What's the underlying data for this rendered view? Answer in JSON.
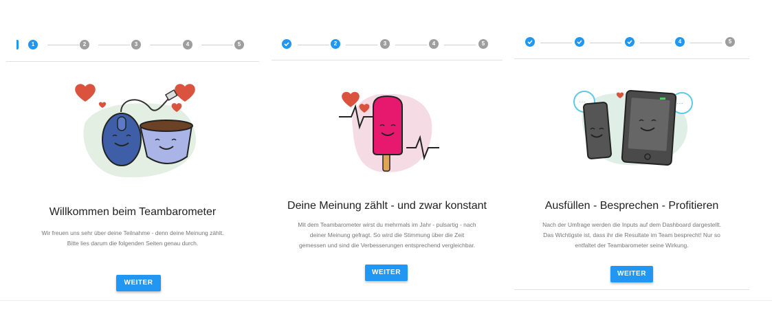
{
  "colors": {
    "accent": "#2196f3",
    "inactive_step": "#9e9e9e",
    "heart": "#d9533f"
  },
  "panels": [
    {
      "steps": [
        "1",
        "2",
        "3",
        "4",
        "5"
      ],
      "active_step": 1,
      "title": "Willkommen beim Teambarometer",
      "description": [
        "Wir freuen uns sehr über deine Teilnahme - denn deine Meinung zählt.",
        "Bitte lies darum die folgenden Seiten genau durch."
      ],
      "button": "WEITER",
      "illustration": "mouse-and-cup"
    },
    {
      "steps": [
        "1",
        "2",
        "3",
        "4",
        "5"
      ],
      "active_step": 2,
      "title": "Deine Meinung zählt - und zwar konstant",
      "description": [
        "Mit dem Teambarometer wirst du mehrmals im Jahr - pulsartig - nach",
        "deiner Meinung gefragt. So wird die Stimmung über die Zeit",
        "gemessen und sind die Verbesserungen entsprechend vergleichbar."
      ],
      "button": "WEITER",
      "illustration": "popsicle-heartbeat"
    },
    {
      "steps": [
        "1",
        "2",
        "3",
        "4",
        "5"
      ],
      "active_step": 4,
      "title": "Ausfüllen - Besprechen - Profitieren",
      "description": [
        "Nach der Umfrage werden die Inputs auf dem Dashboard dargestellt.",
        "Das Wichtigste ist, dass ihr die Resultate im Team besprecht! Nur so",
        "entfaltet der Teambarometer seine Wirkung."
      ],
      "button": "WEITER",
      "illustration": "phone-and-tablet"
    }
  ]
}
